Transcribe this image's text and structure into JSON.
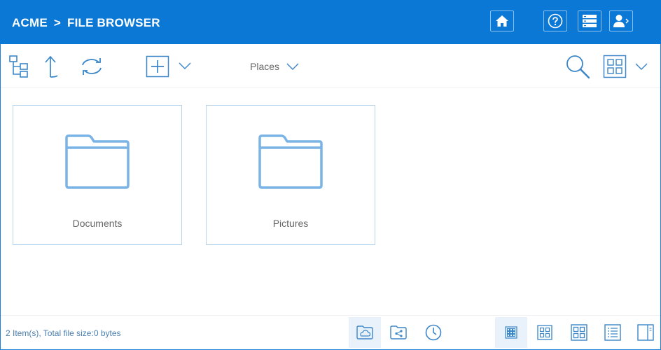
{
  "header": {
    "breadcrumb": [
      {
        "label": "ACME"
      },
      {
        "label": "FILE BROWSER"
      }
    ],
    "separator": ">",
    "buttons": [
      {
        "name": "home-icon"
      },
      {
        "name": "help-icon"
      },
      {
        "name": "list-icon"
      },
      {
        "name": "user-icon"
      }
    ],
    "bg_color": "#0b78d6"
  },
  "toolbar": {
    "places_label": "Places",
    "icons": [
      "folder-tree-icon",
      "up-arrow-icon",
      "refresh-icon",
      "add-icon",
      "chevron-down-icon",
      "search-icon",
      "grid-view-icon",
      "chevron-down-icon"
    ]
  },
  "items": [
    {
      "name": "Documents",
      "icon": "folder-icon"
    },
    {
      "name": "Pictures",
      "icon": "folder-icon"
    }
  ],
  "footer": {
    "status": "2 Item(s), Total file size:0 bytes",
    "location_icons": [
      "cloud-folder-icon",
      "shared-folder-icon",
      "recent-icon"
    ],
    "view_icons": [
      "small-grid-view-icon",
      "medium-grid-view-icon",
      "large-grid-view-icon",
      "details-view-icon",
      "preview-pane-icon"
    ],
    "active_location": "cloud-folder-icon",
    "active_view": "small-grid-view-icon"
  },
  "colors": {
    "accent": "#0b78d6",
    "icon": "#3a86c8",
    "folder": "#7ab3e6"
  }
}
